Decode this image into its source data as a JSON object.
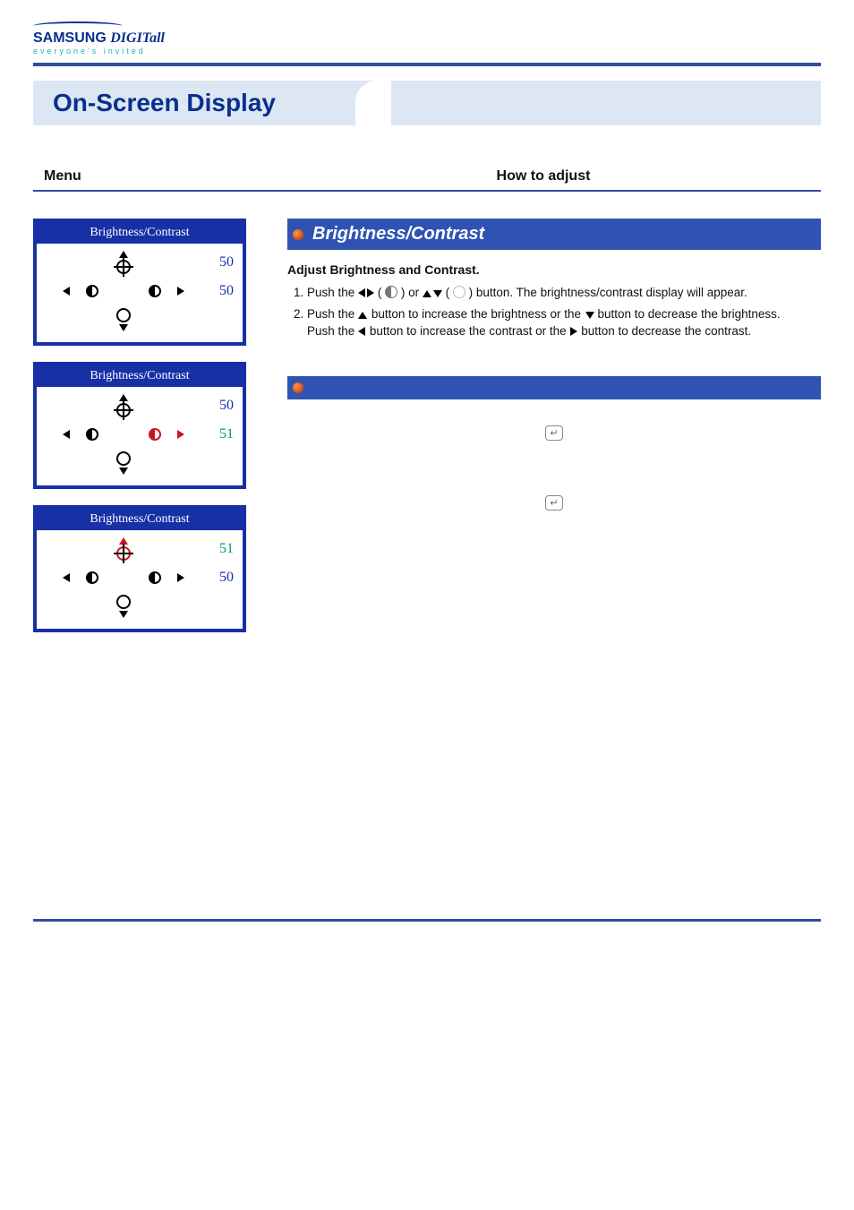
{
  "brand": {
    "name_primary": "SAMSUNG",
    "name_secondary": "DIGITall",
    "tagline": "everyone's invited"
  },
  "page_title": "On-Screen Display",
  "columns": {
    "menu": "Menu",
    "howto": "How to adjust"
  },
  "osd_panels": [
    {
      "title": "Brightness/Contrast",
      "brightness_value": "50",
      "contrast_value": "50",
      "active": "none"
    },
    {
      "title": "Brightness/Contrast",
      "brightness_value": "50",
      "contrast_value": "51",
      "active": "contrast"
    },
    {
      "title": "Brightness/Contrast",
      "brightness_value": "51",
      "contrast_value": "50",
      "active": "brightness"
    }
  ],
  "section": {
    "title": "Brightness/Contrast",
    "subtitle": "Adjust Brightness and Contrast.",
    "step1_a": "Push the ",
    "step1_b": " ( ",
    "step1_c": " ) or ",
    "step1_d": " ( ",
    "step1_e": " ) button. The brightness/contrast display will appear.",
    "step2_a": "Push the ",
    "step2_b": " button to increase the brightness or the ",
    "step2_c": " button to decrease the brightness.",
    "step2_d": "Push the ",
    "step2_e": " button to increase the contrast or the ",
    "step2_f": " button to decrease the contrast."
  },
  "enter_glyph": "↵"
}
